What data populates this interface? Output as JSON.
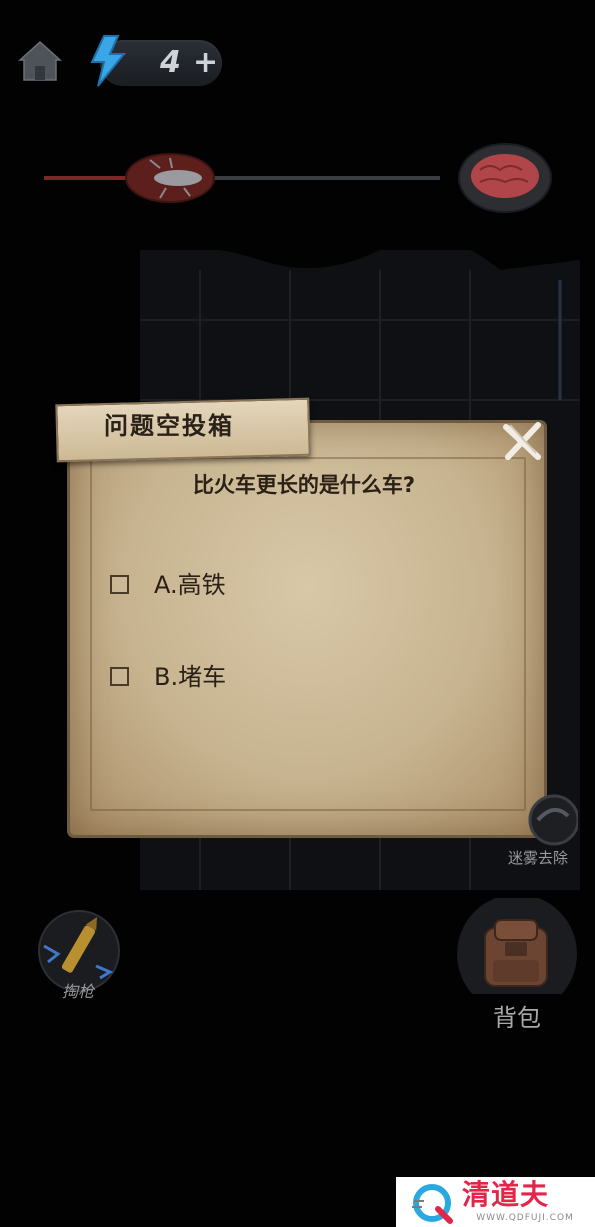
{
  "hud": {
    "home_icon": "home-icon",
    "energy_icon": "lightning-icon",
    "energy_count": "4",
    "energy_plus": "+"
  },
  "progress": {
    "start_icon": "bug-on-spoon-icon",
    "end_icon": "brain-on-spoon-icon",
    "accent": "#7a2a24"
  },
  "dialog": {
    "title": "问题空投箱",
    "question": "比火车更长的是什么车?",
    "options": [
      {
        "label": "A.高铁",
        "checked": false
      },
      {
        "label": "B.堵车",
        "checked": false
      }
    ],
    "close_icon": "close-icon"
  },
  "controls": {
    "mist_label": "迷雾去除",
    "gun_label": "掏枪",
    "bag_label": "背包"
  },
  "watermark": {
    "brand": "清道夫",
    "url": "WWW.QDFUJI.COM"
  }
}
